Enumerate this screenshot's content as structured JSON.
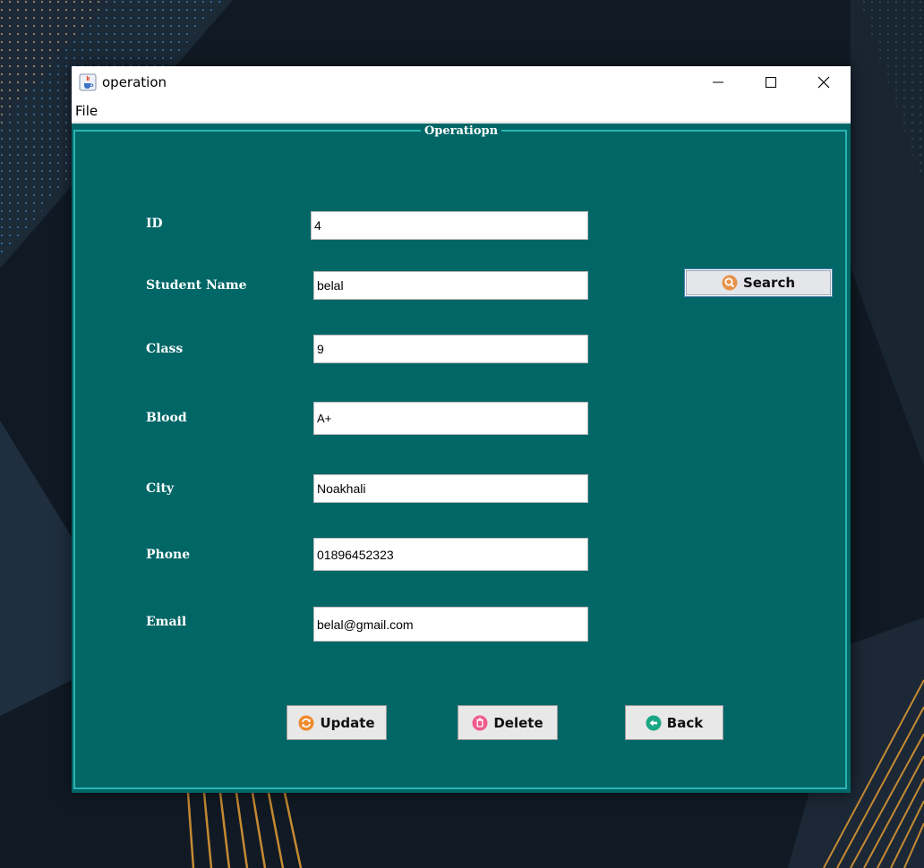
{
  "window": {
    "title": "operation",
    "icon": "java-cup-icon",
    "controls": [
      "minimize-icon",
      "maximize-icon",
      "close-icon"
    ]
  },
  "menu": {
    "file": "File"
  },
  "panel": {
    "title": "Operatiopn"
  },
  "form": {
    "id": {
      "label": "ID",
      "value": "4"
    },
    "name": {
      "label": "Student Name",
      "value": "belal"
    },
    "class": {
      "label": "Class",
      "value": "9"
    },
    "blood": {
      "label": "Blood",
      "value": "A+"
    },
    "city": {
      "label": "City",
      "value": "Noakhali"
    },
    "phone": {
      "label": "Phone",
      "value": "01896452323"
    },
    "email": {
      "label": "Email",
      "value": "belal@gmail.com"
    }
  },
  "buttons": {
    "search": "Search",
    "update": "Update",
    "delete": "Delete",
    "back": "Back"
  },
  "colors": {
    "panel_bg": "#006666",
    "panel_border": "#2bb3b3",
    "search_icon": "#e8934a",
    "update_icon": "#ee8a2a",
    "delete_icon": "#ef5a8c",
    "back_icon": "#1aa884"
  }
}
